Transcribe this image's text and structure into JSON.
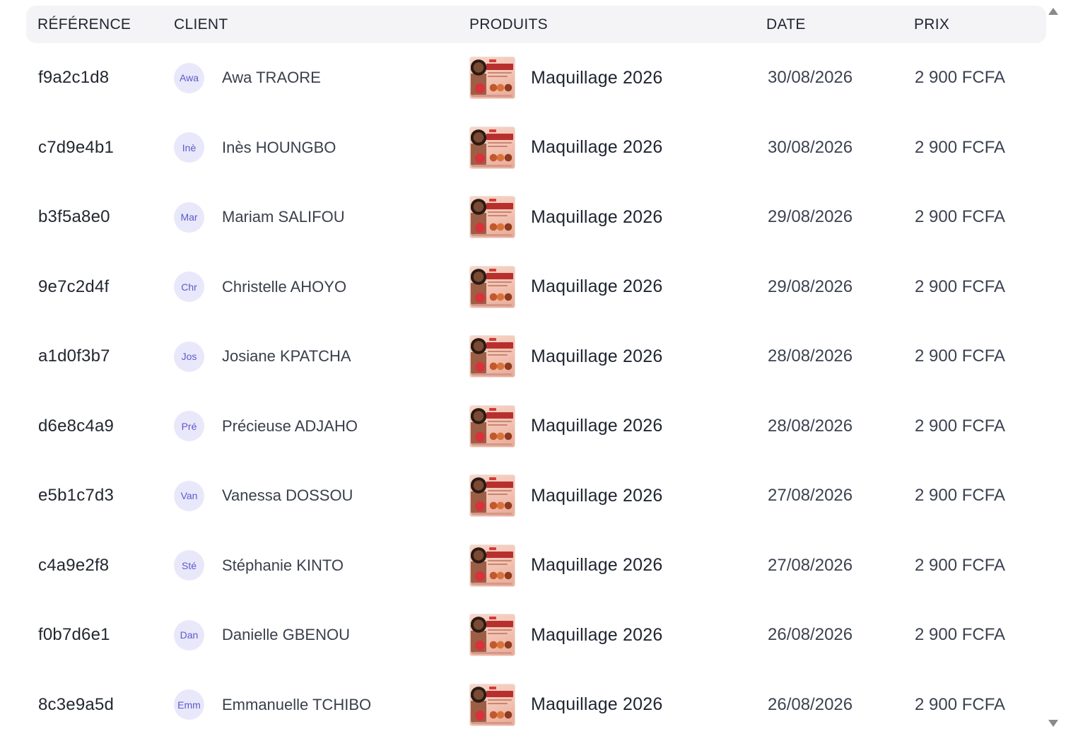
{
  "table": {
    "columns": {
      "reference": "RÉFÉRENCE",
      "client": "CLIENT",
      "products": "PRODUITS",
      "date": "DATE",
      "price": "PRIX"
    },
    "rows": [
      {
        "reference": "f9a2c1d8",
        "avatar": "Awa",
        "client": "Awa TRAORE",
        "product": "Maquillage 2026",
        "date": "30/08/2026",
        "price": "2 900 FCFA"
      },
      {
        "reference": "c7d9e4b1",
        "avatar": "Inè",
        "client": "Inès HOUNGBO",
        "product": "Maquillage 2026",
        "date": "30/08/2026",
        "price": "2 900 FCFA"
      },
      {
        "reference": "b3f5a8e0",
        "avatar": "Mar",
        "client": "Mariam SALIFOU",
        "product": "Maquillage 2026",
        "date": "29/08/2026",
        "price": "2 900 FCFA"
      },
      {
        "reference": "9e7c2d4f",
        "avatar": "Chr",
        "client": "Christelle AHOYO",
        "product": "Maquillage 2026",
        "date": "29/08/2026",
        "price": "2 900 FCFA"
      },
      {
        "reference": "a1d0f3b7",
        "avatar": "Jos",
        "client": "Josiane KPATCHA",
        "product": "Maquillage 2026",
        "date": "28/08/2026",
        "price": "2 900 FCFA"
      },
      {
        "reference": "d6e8c4a9",
        "avatar": "Pré",
        "client": "Précieuse ADJAHO",
        "product": "Maquillage 2026",
        "date": "28/08/2026",
        "price": "2 900 FCFA"
      },
      {
        "reference": "e5b1c7d3",
        "avatar": "Van",
        "client": "Vanessa DOSSOU",
        "product": "Maquillage 2026",
        "date": "27/08/2026",
        "price": "2 900 FCFA"
      },
      {
        "reference": "c4a9e2f8",
        "avatar": "Sté",
        "client": "Stéphanie KINTO",
        "product": "Maquillage 2026",
        "date": "27/08/2026",
        "price": "2 900 FCFA"
      },
      {
        "reference": "f0b7d6e1",
        "avatar": "Dan",
        "client": "Danielle GBENOU",
        "product": "Maquillage 2026",
        "date": "26/08/2026",
        "price": "2 900 FCFA"
      },
      {
        "reference": "8c3e9a5d",
        "avatar": "Emm",
        "client": "Emmanuelle TCHIBO",
        "product": "Maquillage 2026",
        "date": "26/08/2026",
        "price": "2 900 FCFA"
      }
    ]
  },
  "icons": {
    "product_thumbnail": "product-thumbnail-image",
    "scroll_up": "triangle-up-icon",
    "scroll_down": "triangle-down-icon"
  },
  "colors": {
    "header_bg": "#f4f4f6",
    "avatar_bg": "#e9e8fb",
    "avatar_text": "#5b5bc8"
  }
}
